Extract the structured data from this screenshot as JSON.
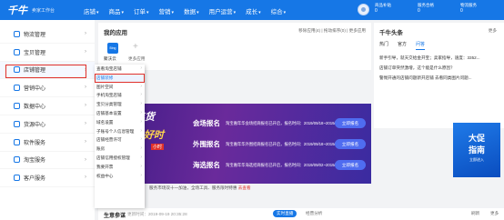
{
  "header": {
    "logo": "千牛",
    "logo_sub": "卖家工作台",
    "nav": [
      "店铺",
      "商品",
      "订单",
      "营销",
      "数据",
      "用户运营",
      "成长",
      "综合"
    ],
    "stats": [
      {
        "label": "商品补贴",
        "value": "0"
      },
      {
        "label": "服务合格",
        "value": "0"
      },
      {
        "label": "物流服务",
        "value": "0"
      }
    ]
  },
  "sidebar": {
    "items": [
      {
        "label": "物流管理"
      },
      {
        "label": "宝贝管理"
      },
      {
        "label": "店铺管理"
      },
      {
        "label": "营销中心"
      },
      {
        "label": "数据中心"
      },
      {
        "label": "货源中心"
      },
      {
        "label": "软件服务"
      },
      {
        "label": "淘宝服务"
      },
      {
        "label": "客户服务"
      }
    ]
  },
  "flyout": {
    "items": [
      "查看淘宝店铺",
      "店铺装修",
      "图片空间",
      "手机淘宝店铺",
      "宝贝分类管理",
      "店铺基本设置",
      "域名设置",
      "子账号个人信息管理",
      "店铺经营许可",
      "账房",
      "店铺信用授权管理",
      "我要开票",
      "权益中心"
    ]
  },
  "apps": {
    "title": "我的应用",
    "links": "移除应用(4) | 拖动排序(0) | 更多应用",
    "app_tile_text": "Bing",
    "app_label": "聚沃云",
    "add_label": "更多应用"
  },
  "news": {
    "title": "千牛头条",
    "more": "更多",
    "tabs": [
      "热门",
      "官方",
      "问答"
    ],
    "items": [
      "新手引导，就天交给金开宝；卖家指导，速度：3352...",
      "店铺订单突然激增，这个能是什么原因？",
      "警惕开通的店铺问题新开店铺 去看同类图片问题..."
    ]
  },
  "banner": {
    "left_big": "年货",
    "left_big2": "好时",
    "left_tag": "小时",
    "rows": [
      {
        "label": "会场报名",
        "desc": "淘宝嘉年华会场招商报名已开启，报名时间：2019/09/18~2019/10/23",
        "btn": "立即报名"
      },
      {
        "label": "外围报名",
        "desc": "淘宝嘉年华外围招商报名已开启，报名时间：2019/09/18~2019/11/11",
        "btn": "立即报名"
      },
      {
        "label": "海选报名",
        "desc": "淘宝嘉年华海选招商报名已开启，报名时间：2019/09/02~2019/09/19",
        "btn": "立即报名"
      }
    ]
  },
  "promo": {
    "t1": "大促",
    "t2": "指南",
    "t3": "立即进入"
  },
  "notice": {
    "text": "服务市场双十一加油，全场工具、服务限时特惠",
    "link": "去查看"
  },
  "bottom": {
    "title": "生意参谋",
    "sub": "更新时间：2019-09-19 20:35:28",
    "pill": "实时直播",
    "pill2": "经营分析",
    "r1": "刷新",
    "r2": "更多"
  }
}
